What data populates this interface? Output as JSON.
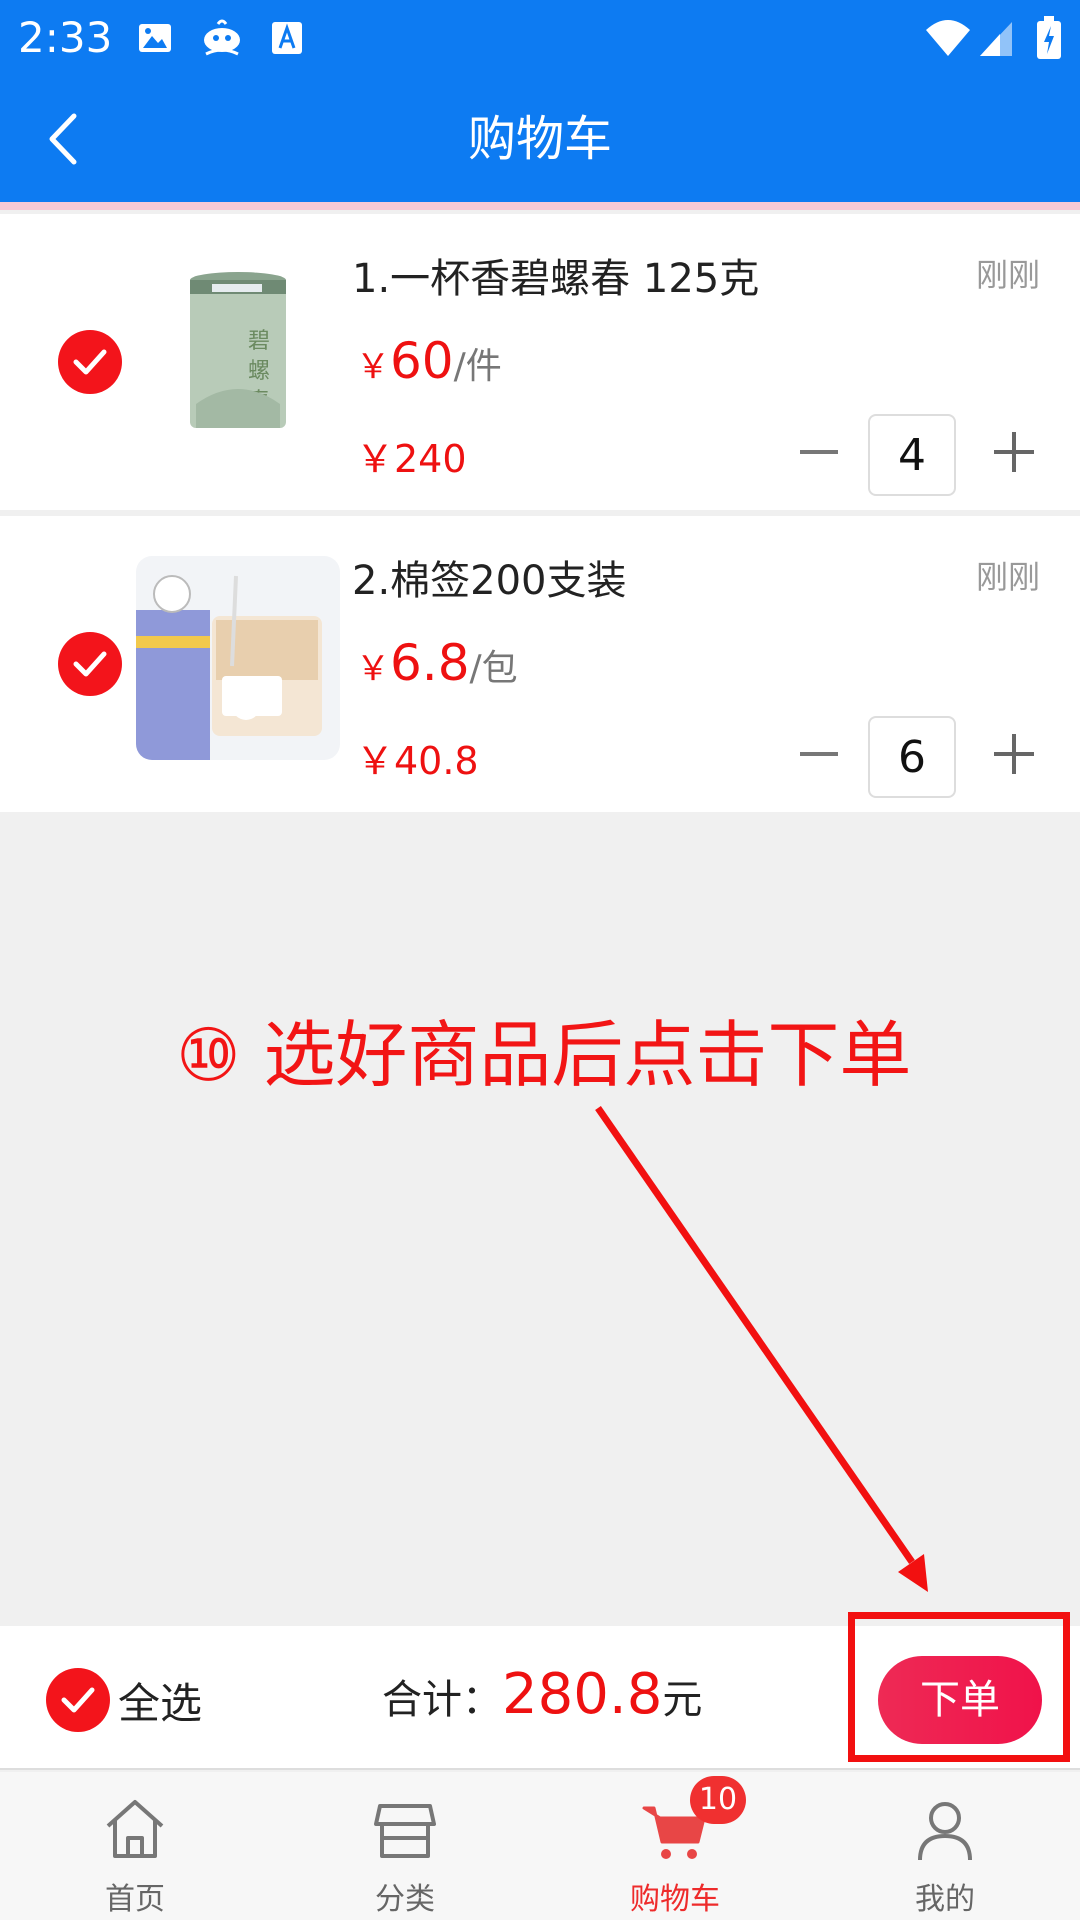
{
  "status_bar": {
    "time": "2:33"
  },
  "header": {
    "title": "购物车"
  },
  "cart": {
    "items": [
      {
        "name": "1.一杯香碧螺春 125克",
        "time": "刚刚",
        "currency": "￥",
        "price": "60",
        "unit": "/件",
        "subtotal": "￥240",
        "qty": "4"
      },
      {
        "name": "2.棉签200支装",
        "time": "刚刚",
        "currency": "￥",
        "price": "6.8",
        "unit": "/包",
        "subtotal": "￥40.8",
        "qty": "6"
      }
    ]
  },
  "annotation": {
    "text": "⑩ 选好商品后点击下单"
  },
  "summary": {
    "select_all": "全选",
    "total_label": "合计：",
    "total_value": "280.8",
    "total_unit": "元",
    "order_button": "下单"
  },
  "tabbar": {
    "tabs": [
      {
        "label": "首页",
        "icon": "home-icon"
      },
      {
        "label": "分类",
        "icon": "store-icon"
      },
      {
        "label": "购物车",
        "icon": "cart-icon",
        "badge": "10",
        "active": true
      },
      {
        "label": "我的",
        "icon": "user-icon"
      }
    ]
  },
  "colors": {
    "primary": "#0d7bf2",
    "accent_red": "#ee1111",
    "check_red": "#f3141b",
    "tab_active": "#ee2b2b"
  }
}
